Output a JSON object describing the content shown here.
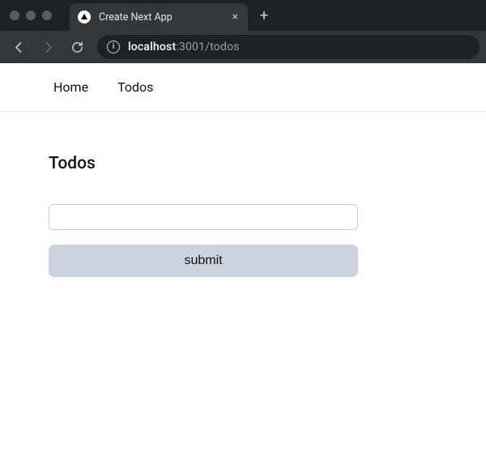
{
  "browser": {
    "tab_title": "Create Next App",
    "url": {
      "host": "localhost",
      "rest": ":3001/todos"
    }
  },
  "nav": {
    "items": [
      {
        "label": "Home"
      },
      {
        "label": "Todos"
      }
    ]
  },
  "page": {
    "heading": "Todos",
    "input_value": "",
    "submit_label": "submit"
  }
}
